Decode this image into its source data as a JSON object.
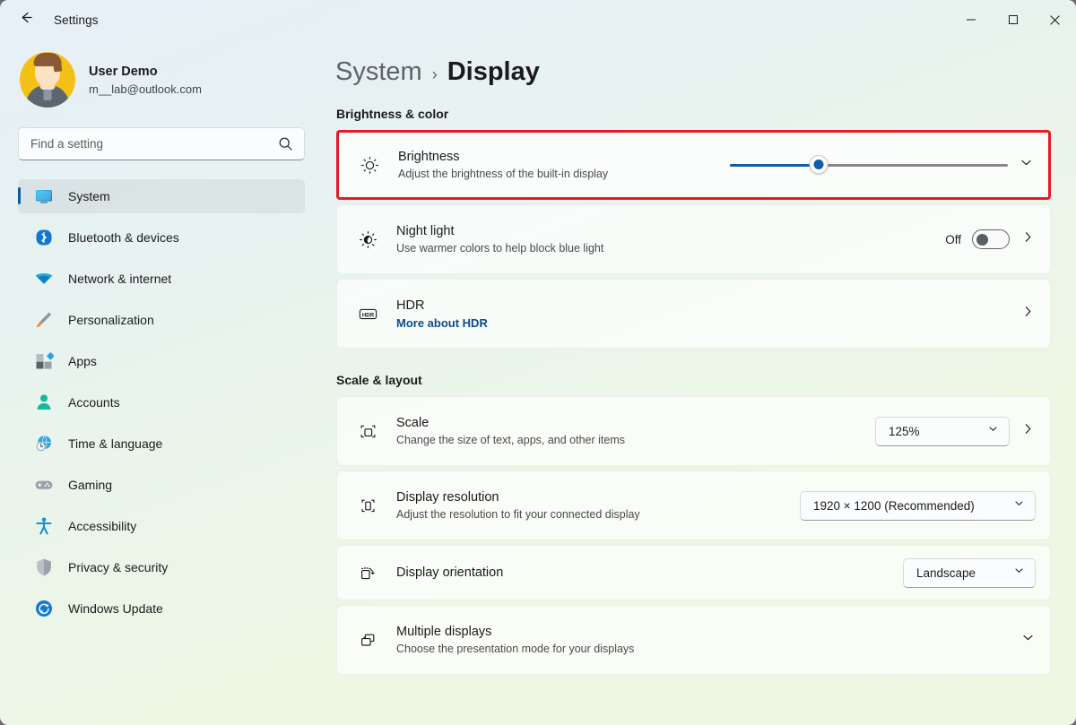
{
  "window": {
    "app_title": "Settings",
    "back_icon": "back-arrow-icon",
    "minimize_icon": "minimize-icon",
    "maximize_icon": "maximize-icon",
    "close_icon": "close-icon"
  },
  "account": {
    "name": "User Demo",
    "email": "m__lab@outlook.com",
    "avatar_icon": "user-avatar"
  },
  "search": {
    "placeholder": "Find a setting",
    "value": "",
    "icon": "search-icon"
  },
  "sidebar": {
    "items": [
      {
        "label": "System",
        "icon": "monitor-icon",
        "selected": true
      },
      {
        "label": "Bluetooth & devices",
        "icon": "bluetooth-icon",
        "selected": false
      },
      {
        "label": "Network & internet",
        "icon": "wifi-icon",
        "selected": false
      },
      {
        "label": "Personalization",
        "icon": "paintbrush-icon",
        "selected": false
      },
      {
        "label": "Apps",
        "icon": "apps-icon",
        "selected": false
      },
      {
        "label": "Accounts",
        "icon": "person-icon",
        "selected": false
      },
      {
        "label": "Time & language",
        "icon": "clock-globe-icon",
        "selected": false
      },
      {
        "label": "Gaming",
        "icon": "gamepad-icon",
        "selected": false
      },
      {
        "label": "Accessibility",
        "icon": "accessibility-icon",
        "selected": false
      },
      {
        "label": "Privacy & security",
        "icon": "shield-icon",
        "selected": false
      },
      {
        "label": "Windows Update",
        "icon": "update-icon",
        "selected": false
      }
    ]
  },
  "breadcrumb": {
    "root": "System",
    "separator": "›",
    "current": "Display"
  },
  "sections": {
    "brightness_color": {
      "title": "Brightness & color",
      "brightness": {
        "title": "Brightness",
        "subtitle": "Adjust the brightness of the built-in display",
        "icon": "brightness-sun-icon",
        "slider_percent": 32,
        "expand_icon": "chevron-down-icon",
        "highlighted": true,
        "highlight_color": "#e31b23"
      },
      "night_light": {
        "title": "Night light",
        "subtitle": "Use warmer colors to help block blue light",
        "icon": "night-light-icon",
        "toggle_label": "Off",
        "toggle_state": "off",
        "chevron_icon": "chevron-right-icon"
      },
      "hdr": {
        "title": "HDR",
        "link": "More about HDR",
        "icon": "hdr-icon",
        "chevron_icon": "chevron-right-icon"
      }
    },
    "scale_layout": {
      "title": "Scale & layout",
      "scale": {
        "title": "Scale",
        "subtitle": "Change the size of text, apps, and other items",
        "icon": "scale-icon",
        "value": "125%",
        "caret_icon": "chevron-down-icon",
        "chevron_icon": "chevron-right-icon"
      },
      "display_resolution": {
        "title": "Display resolution",
        "subtitle": "Adjust the resolution to fit your connected display",
        "icon": "resolution-icon",
        "value": "1920 × 1200 (Recommended)",
        "caret_icon": "chevron-down-icon"
      },
      "display_orientation": {
        "title": "Display orientation",
        "subtitle": "",
        "icon": "orientation-icon",
        "value": "Landscape",
        "caret_icon": "chevron-down-icon"
      },
      "multiple_displays": {
        "title": "Multiple displays",
        "subtitle": "Choose the presentation mode for your displays",
        "icon": "multiple-displays-icon",
        "expand_icon": "chevron-down-icon"
      }
    }
  },
  "colors": {
    "accent": "#0f5eaa",
    "highlight": "#e31b23",
    "link": "#0f4c8c",
    "bg_top": "#e7f0f7",
    "bg_bottom": "#eef7e2"
  }
}
